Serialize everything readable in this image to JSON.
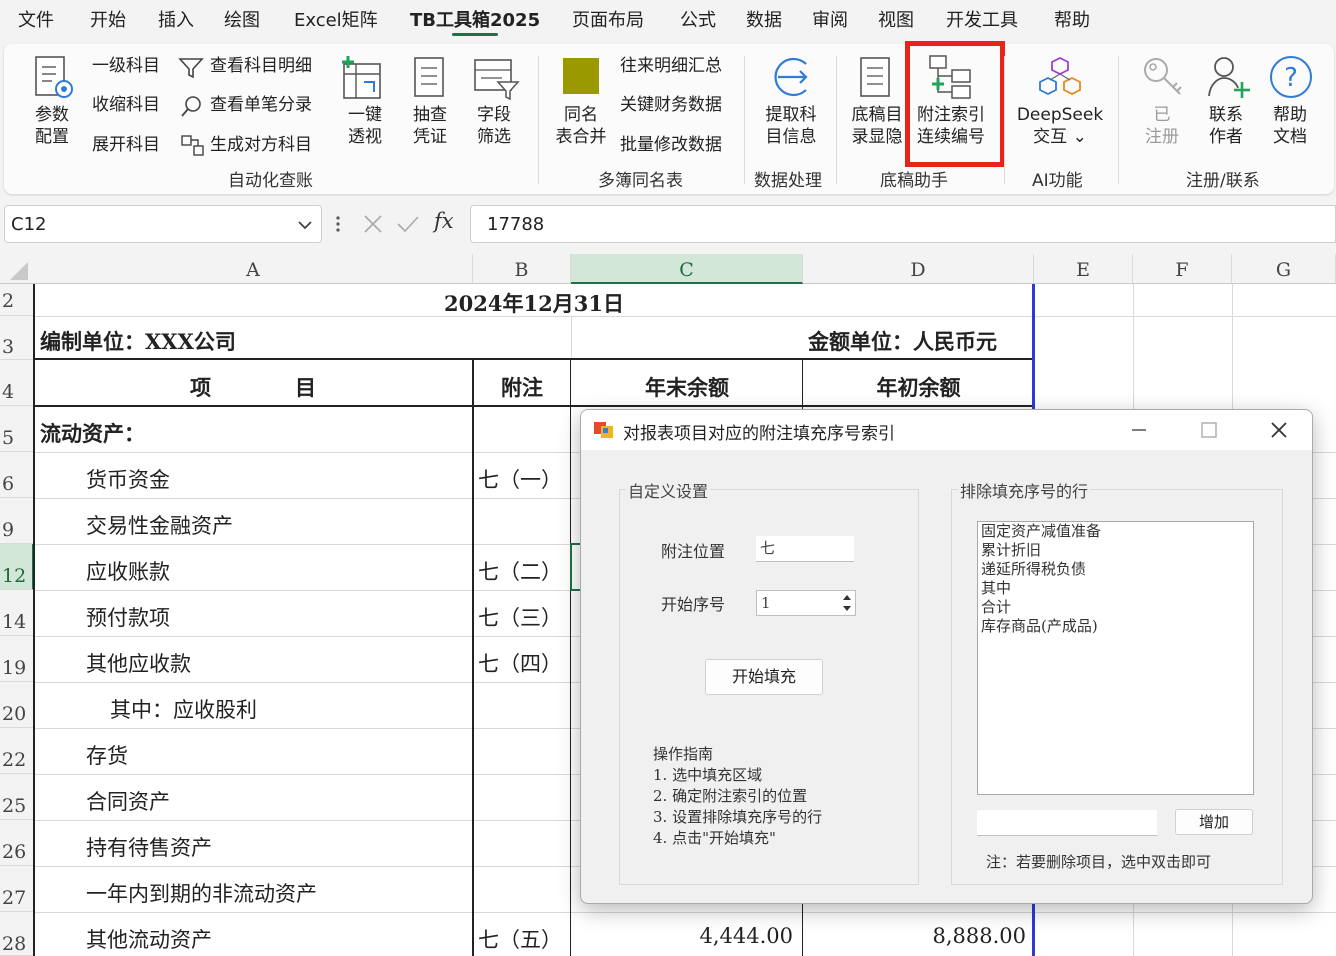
{
  "menu": {
    "tabs": [
      "文件",
      "开始",
      "插入",
      "绘图",
      "Excel矩阵",
      "TB工具箱2025",
      "页面布局",
      "公式",
      "数据",
      "审阅",
      "视图",
      "开发工具",
      "帮助"
    ]
  },
  "ribbon": {
    "params": [
      "参数",
      "配置"
    ],
    "level1": "一级科目",
    "collapse": "收缩科目",
    "expand": "展开科目",
    "view_detail": "查看科目明细",
    "view_single": "查看单笔分录",
    "gen_contra": "生成对方科目",
    "pivot": [
      "一键",
      "透视"
    ],
    "sample": [
      "抽查",
      "凭证"
    ],
    "field_filter": [
      "字段",
      "筛选"
    ],
    "group_auto": "自动化查账",
    "merge": [
      "同名",
      "表合并"
    ],
    "ar_summary": "往来明细汇总",
    "key_finance": "关键财务数据",
    "batch_edit": "批量修改数据",
    "group_multi": "多簿同名表",
    "extract": [
      "提取科",
      "目信息"
    ],
    "group_data": "数据处理",
    "draft_hide": [
      "底稿目",
      "录显隐"
    ],
    "note_index": [
      "附注索引",
      "连续编号"
    ],
    "group_draft": "底稿助手",
    "deepseek": [
      "DeepSeek",
      "交互 ⌄"
    ],
    "group_ai": "AI功能",
    "registered": [
      "已",
      "注册"
    ],
    "contact": [
      "联系",
      "作者"
    ],
    "help": [
      "帮助",
      "文档"
    ],
    "group_reg": "注册/联系"
  },
  "formula_bar": {
    "name_box": "C12",
    "fx": "fx",
    "value": "17788"
  },
  "grid": {
    "columns": [
      "A",
      "B",
      "C",
      "D",
      "E",
      "F",
      "G"
    ],
    "rows": [
      "2",
      "3",
      "4",
      "5",
      "6",
      "9",
      "12",
      "14",
      "19",
      "20",
      "22",
      "25",
      "26",
      "27",
      "28"
    ],
    "date_title": "2024年12月31日",
    "unit_left": "编制单位：XXX公司",
    "unit_right": "金额单位：人民币元",
    "hdr_item": "项　　　　目",
    "hdr_note": "附注",
    "hdr_end": "年末余额",
    "hdr_begin": "年初余额",
    "items": [
      {
        "label": "流动资产：",
        "note": ""
      },
      {
        "label": "货币资金",
        "note": "七（一）"
      },
      {
        "label": "交易性金融资产",
        "note": ""
      },
      {
        "label": "应收账款",
        "note": "七（二）"
      },
      {
        "label": "预付款项",
        "note": "七（三）"
      },
      {
        "label": "其他应收款",
        "note": "七（四）"
      },
      {
        "label": "其中：应收股利",
        "note": ""
      },
      {
        "label": "存货",
        "note": ""
      },
      {
        "label": "合同资产",
        "note": ""
      },
      {
        "label": "持有待售资产",
        "note": ""
      },
      {
        "label": "一年内到期的非流动资产",
        "note": ""
      },
      {
        "label": "其他流动资产",
        "note": "七（五）"
      }
    ],
    "last_end": "4,444.00",
    "last_begin": "8,888.00"
  },
  "dialog": {
    "title": "对报表项目对应的附注填充序号索引",
    "settings_legend": "自定义设置",
    "note_pos_label": "附注位置",
    "note_pos_value": "七",
    "start_no_label": "开始序号",
    "start_no_value": "1",
    "fill_button": "开始填充",
    "guide_title": "操作指南",
    "guide": [
      "1. 选中填充区域",
      "2. 确定附注索引的位置",
      "3. 设置排除填充序号的行",
      "4. 点击\"开始填充\""
    ],
    "exclude_legend": "排除填充序号的行",
    "exclude_items": [
      "固定资产减值准备",
      "累计折旧",
      "递延所得税负债",
      "其中",
      "合计",
      "库存商品(产成品)"
    ],
    "add_input": "",
    "add_button": "增加",
    "hint": "注：若要删除项目，选中双击即可"
  },
  "colors": {
    "accent_green": "#1e7145",
    "highlight_red": "#e8231a",
    "border_blue": "#2b3bd6"
  }
}
